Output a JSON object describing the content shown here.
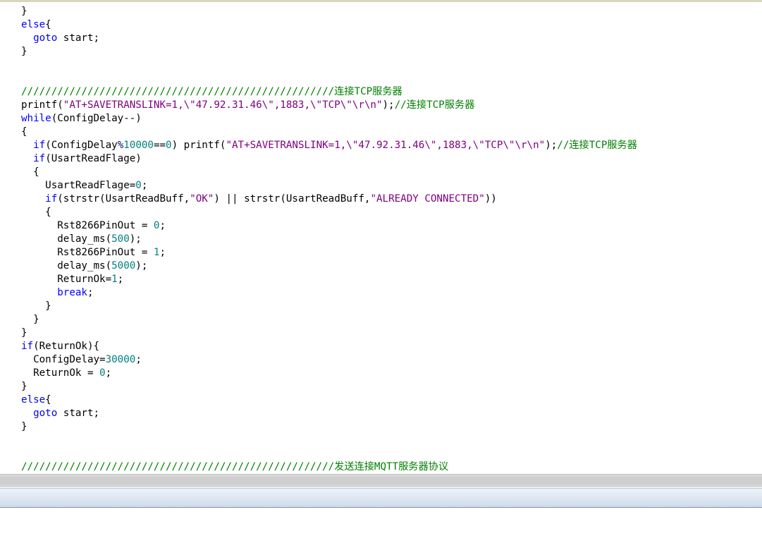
{
  "editor": {
    "lines": [
      [
        {
          "t": "}",
          "c": "p"
        }
      ],
      [
        {
          "t": "else",
          "c": "kw"
        },
        {
          "t": "{",
          "c": "p"
        }
      ],
      [
        {
          "t": "  ",
          "c": "p"
        },
        {
          "t": "goto",
          "c": "kw"
        },
        {
          "t": " start;",
          "c": "p"
        }
      ],
      [
        {
          "t": "}",
          "c": "p"
        }
      ],
      [],
      [],
      [
        {
          "t": "////////////////////////////////////////////////////连接TCP服务器",
          "c": "cm"
        }
      ],
      [
        {
          "t": "printf(",
          "c": "p"
        },
        {
          "t": "\"AT+SAVETRANSLINK=1,\\\"47.92.31.46\\\",1883,\\\"TCP\\\"\\r\\n\"",
          "c": "str"
        },
        {
          "t": ");",
          "c": "p"
        },
        {
          "t": "//连接TCP服务器",
          "c": "cm"
        }
      ],
      [
        {
          "t": "while",
          "c": "kw"
        },
        {
          "t": "(ConfigDelay--)",
          "c": "p"
        }
      ],
      [
        {
          "t": "{",
          "c": "p"
        }
      ],
      [
        {
          "t": "  ",
          "c": "p"
        },
        {
          "t": "if",
          "c": "kw"
        },
        {
          "t": "(ConfigDelay",
          "c": "p"
        },
        {
          "t": "%",
          "c": "op"
        },
        {
          "t": "10000",
          "c": "num"
        },
        {
          "t": "==",
          "c": "p"
        },
        {
          "t": "0",
          "c": "num"
        },
        {
          "t": ") printf(",
          "c": "p"
        },
        {
          "t": "\"AT+SAVETRANSLINK=1,\\\"47.92.31.46\\\",1883,\\\"TCP\\\"\\r\\n\"",
          "c": "str"
        },
        {
          "t": ");",
          "c": "p"
        },
        {
          "t": "//连接TCP服务器",
          "c": "cm"
        }
      ],
      [
        {
          "t": "  ",
          "c": "p"
        },
        {
          "t": "if",
          "c": "kw"
        },
        {
          "t": "(UsartReadFlage)",
          "c": "p"
        }
      ],
      [
        {
          "t": "  {",
          "c": "p"
        }
      ],
      [
        {
          "t": "    UsartReadFlage=",
          "c": "p"
        },
        {
          "t": "0",
          "c": "num"
        },
        {
          "t": ";",
          "c": "p"
        }
      ],
      [
        {
          "t": "    ",
          "c": "p"
        },
        {
          "t": "if",
          "c": "kw"
        },
        {
          "t": "(strstr(UsartReadBuff,",
          "c": "p"
        },
        {
          "t": "\"OK\"",
          "c": "str"
        },
        {
          "t": ") || strstr(UsartReadBuff,",
          "c": "p"
        },
        {
          "t": "\"ALREADY CONNECTED\"",
          "c": "str"
        },
        {
          "t": "))",
          "c": "p"
        }
      ],
      [
        {
          "t": "    {",
          "c": "p"
        }
      ],
      [
        {
          "t": "      Rst8266PinOut = ",
          "c": "p"
        },
        {
          "t": "0",
          "c": "num"
        },
        {
          "t": ";",
          "c": "p"
        }
      ],
      [
        {
          "t": "      delay_ms(",
          "c": "p"
        },
        {
          "t": "500",
          "c": "num"
        },
        {
          "t": ");",
          "c": "p"
        }
      ],
      [
        {
          "t": "      Rst8266PinOut = ",
          "c": "p"
        },
        {
          "t": "1",
          "c": "num"
        },
        {
          "t": ";",
          "c": "p"
        }
      ],
      [
        {
          "t": "      delay_ms(",
          "c": "p"
        },
        {
          "t": "5000",
          "c": "num"
        },
        {
          "t": ");",
          "c": "p"
        }
      ],
      [
        {
          "t": "      ReturnOk=",
          "c": "p"
        },
        {
          "t": "1",
          "c": "num"
        },
        {
          "t": ";",
          "c": "p"
        }
      ],
      [
        {
          "t": "      ",
          "c": "p"
        },
        {
          "t": "break",
          "c": "kw"
        },
        {
          "t": ";",
          "c": "p"
        }
      ],
      [
        {
          "t": "    }",
          "c": "p"
        }
      ],
      [
        {
          "t": "  }",
          "c": "p"
        }
      ],
      [
        {
          "t": "}",
          "c": "p"
        }
      ],
      [
        {
          "t": "if",
          "c": "kw"
        },
        {
          "t": "(ReturnOk){",
          "c": "p"
        }
      ],
      [
        {
          "t": "  ConfigDelay=",
          "c": "p"
        },
        {
          "t": "30000",
          "c": "num"
        },
        {
          "t": ";",
          "c": "p"
        }
      ],
      [
        {
          "t": "  ReturnOk = ",
          "c": "p"
        },
        {
          "t": "0",
          "c": "num"
        },
        {
          "t": ";",
          "c": "p"
        }
      ],
      [
        {
          "t": "}",
          "c": "p"
        }
      ],
      [
        {
          "t": "else",
          "c": "kw"
        },
        {
          "t": "{",
          "c": "p"
        }
      ],
      [
        {
          "t": "  ",
          "c": "p"
        },
        {
          "t": "goto",
          "c": "kw"
        },
        {
          "t": " start;",
          "c": "p"
        }
      ],
      [
        {
          "t": "}",
          "c": "p"
        }
      ],
      [],
      [],
      [
        {
          "t": "////////////////////////////////////////////////////发送连接MQTT服务器协议",
          "c": "cm"
        }
      ]
    ]
  },
  "colors": {
    "keyword": "#0000ff",
    "string": "#800080",
    "number": "#008080",
    "comment": "#008000",
    "plain": "#000000"
  }
}
